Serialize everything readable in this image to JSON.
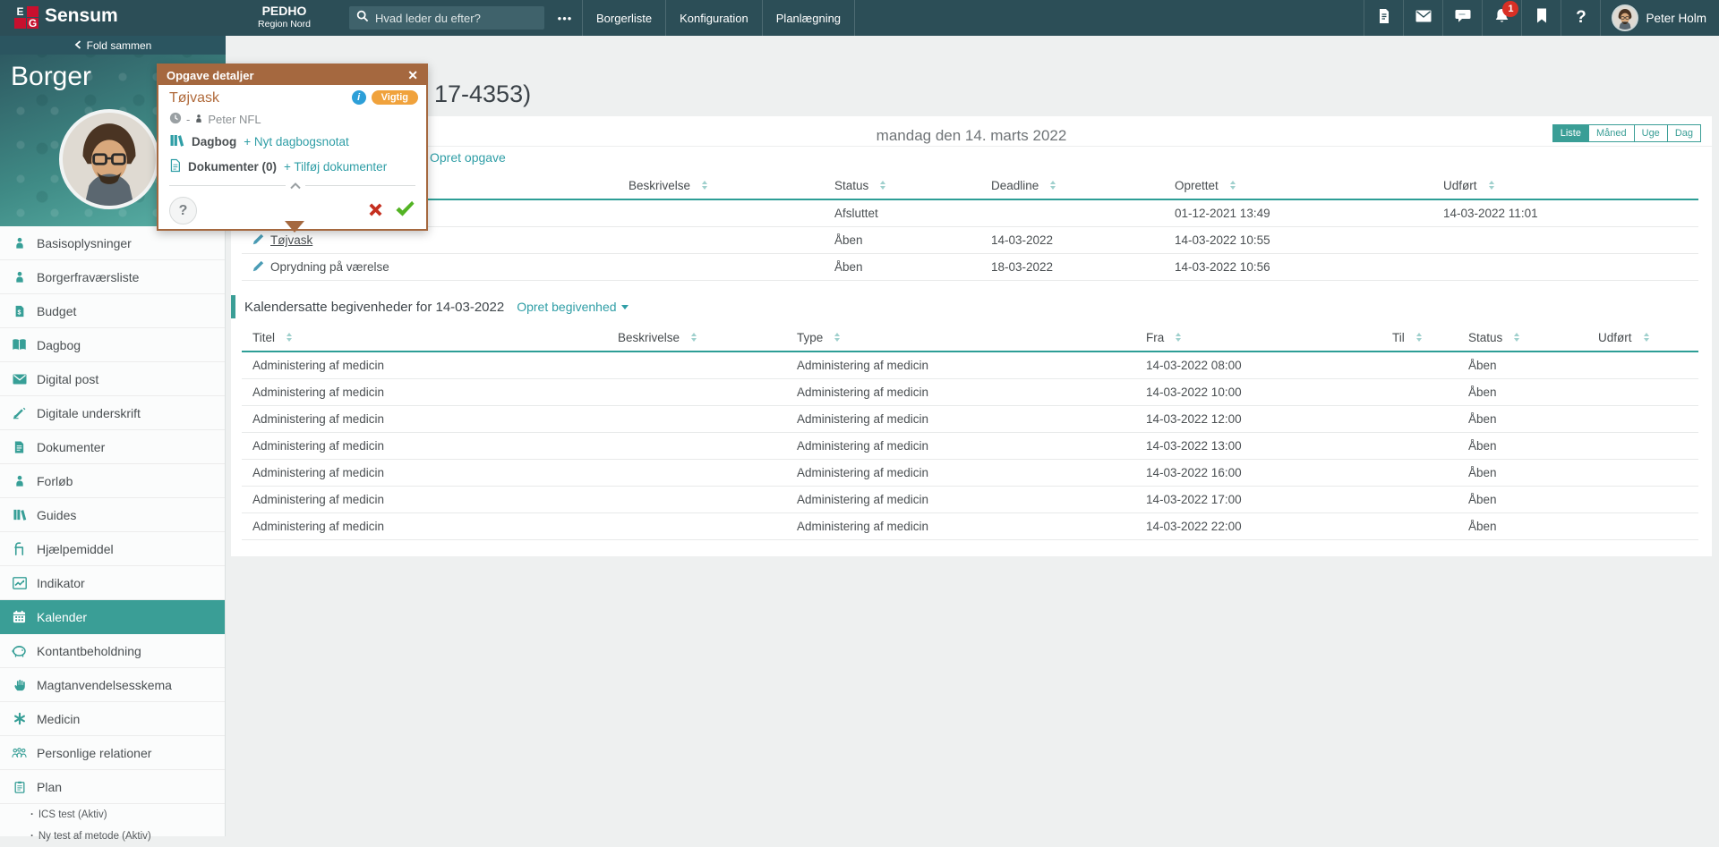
{
  "topbar": {
    "brand": "Sensum",
    "logo_top": "E",
    "logo_bottom": "G",
    "department": "PEDHO",
    "region": "Region Nord",
    "search_placeholder": "Hvad leder du efter?",
    "more_label": "•••",
    "nav": [
      {
        "label": "Borgerliste"
      },
      {
        "label": "Konfiguration"
      },
      {
        "label": "Planlægning"
      }
    ],
    "notification_count": "1",
    "help_glyph": "?",
    "user_name": "Peter Holm"
  },
  "sidebar": {
    "collapse_label": "Fold sammen",
    "section_title": "Borger",
    "items": [
      {
        "label": "Basisoplysninger"
      },
      {
        "label": "Borgerfraværsliste"
      },
      {
        "label": "Budget"
      },
      {
        "label": "Dagbog"
      },
      {
        "label": "Digital post"
      },
      {
        "label": "Digitale underskrift"
      },
      {
        "label": "Dokumenter"
      },
      {
        "label": "Forløb"
      },
      {
        "label": "Guides"
      },
      {
        "label": "Hjælpemiddel"
      },
      {
        "label": "Indikator"
      },
      {
        "label": "Kalender",
        "active": true
      },
      {
        "label": "Kontantbeholdning"
      },
      {
        "label": "Magtanvendelsesskema"
      },
      {
        "label": "Medicin"
      },
      {
        "label": "Personlige relationer"
      },
      {
        "label": "Plan"
      }
    ],
    "plan_children": [
      {
        "label": "ICS test (Aktiv)"
      },
      {
        "label": "Ny test af metode (Aktiv)"
      }
    ]
  },
  "popup": {
    "title": "Opgave detaljer",
    "close_glyph": "✕",
    "task_title": "Tøjvask",
    "important_badge": "Vigtig",
    "info_glyph": "i",
    "assignee_separator": "-",
    "assignee": "Peter NFL",
    "dagbog_label": "Dagbog",
    "dagbog_link": "+ Nyt dagbogsnotat",
    "dokumenter_label": "Dokumenter (0)",
    "dokumenter_link": "+ Tilføj dokumenter",
    "help_label": "?"
  },
  "main": {
    "page_title_visible": "17-4353)",
    "date_heading": "mandag den 14. marts 2022",
    "views": [
      {
        "label": "Liste",
        "active": true
      },
      {
        "label": "Måned"
      },
      {
        "label": "Uge"
      },
      {
        "label": "Dag"
      }
    ],
    "tasks": {
      "create_link": "Opret opgave",
      "columns": [
        "Beskrivelse",
        "Status",
        "Deadline",
        "Oprettet",
        "Udført"
      ],
      "rows": [
        {
          "titel": "",
          "beskrivelse": "",
          "status": "Afsluttet",
          "deadline": "",
          "oprettet": "01-12-2021 13:49",
          "udfort": "14-03-2022 11:01"
        },
        {
          "titel": "Tøjvask",
          "beskrivelse": "",
          "status": "Åben",
          "deadline": "14-03-2022",
          "oprettet": "14-03-2022 10:55",
          "udfort": ""
        },
        {
          "titel": "Oprydning på værelse",
          "beskrivelse": "",
          "status": "Åben",
          "deadline": "18-03-2022",
          "oprettet": "14-03-2022 10:56",
          "udfort": ""
        }
      ]
    },
    "events": {
      "heading": "Kalendersatte begivenheder for 14-03-2022",
      "create_link": "Opret begivenhed",
      "columns": [
        "Titel",
        "Beskrivelse",
        "Type",
        "Fra",
        "Til",
        "Status",
        "Udført"
      ],
      "rows": [
        {
          "titel": "Administering af medicin",
          "type": "Administering af medicin",
          "fra": "14-03-2022 08:00",
          "til": "",
          "status": "Åben",
          "udfort": ""
        },
        {
          "titel": "Administering af medicin",
          "type": "Administering af medicin",
          "fra": "14-03-2022 10:00",
          "til": "",
          "status": "Åben",
          "udfort": ""
        },
        {
          "titel": "Administering af medicin",
          "type": "Administering af medicin",
          "fra": "14-03-2022 12:00",
          "til": "",
          "status": "Åben",
          "udfort": ""
        },
        {
          "titel": "Administering af medicin",
          "type": "Administering af medicin",
          "fra": "14-03-2022 13:00",
          "til": "",
          "status": "Åben",
          "udfort": ""
        },
        {
          "titel": "Administering af medicin",
          "type": "Administering af medicin",
          "fra": "14-03-2022 16:00",
          "til": "",
          "status": "Åben",
          "udfort": ""
        },
        {
          "titel": "Administering af medicin",
          "type": "Administering af medicin",
          "fra": "14-03-2022 17:00",
          "til": "",
          "status": "Åben",
          "udfort": ""
        },
        {
          "titel": "Administering af medicin",
          "type": "Administering af medicin",
          "fra": "14-03-2022 22:00",
          "til": "",
          "status": "Åben",
          "udfort": ""
        }
      ]
    }
  },
  "colors": {
    "topbar": "#2c4e57",
    "accent_teal": "#3a9e96",
    "link_teal": "#2f9ea6",
    "popup_brown": "#a5683f",
    "badge_orange": "#f0a23c",
    "alert_red": "#c52f1f",
    "success_green": "#53b324"
  }
}
